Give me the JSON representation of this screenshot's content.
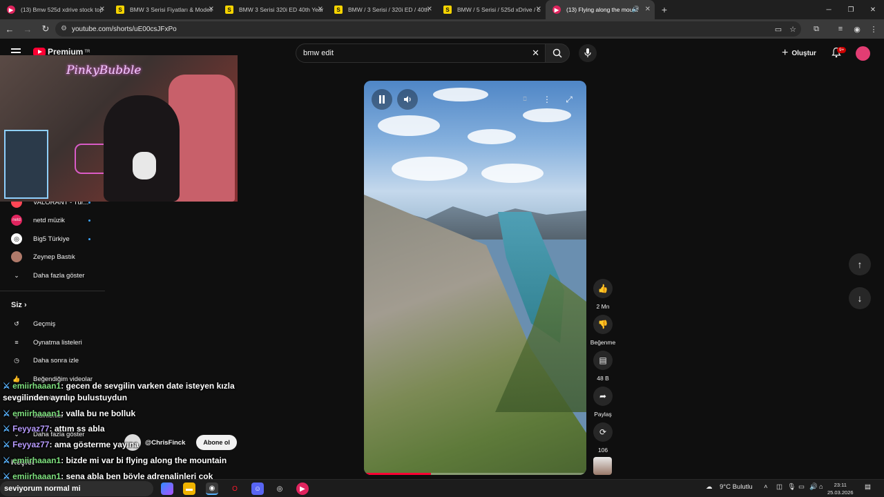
{
  "browser": {
    "tabs": [
      {
        "title": "(13) Bmw 525d xdrive stock top",
        "icon": "yt",
        "active": false
      },
      {
        "title": "BMW 3 Serisi Fiyatları & Modell",
        "icon": "s",
        "active": false
      },
      {
        "title": "BMW 3 Serisi 320i ED 40th Year",
        "icon": "s",
        "active": false
      },
      {
        "title": "BMW / 3 Serisi / 320i ED / 40th",
        "icon": "s",
        "active": false
      },
      {
        "title": "BMW / 5 Serisi / 525d xDrive / L",
        "icon": "s",
        "active": false
      },
      {
        "title": "(13) Flying along the mount",
        "icon": "yt",
        "active": true
      }
    ],
    "url": "youtube.com/shorts/uE00csJFxPo",
    "window_controls": [
      "─",
      "❐",
      "✕"
    ]
  },
  "youtube": {
    "logo_text": "Premium",
    "logo_region": "TR",
    "search_value": "bmw edit",
    "create_label": "Oluştur",
    "notification_count": "9+"
  },
  "webcam": {
    "neon_sign": "PinkyBubble"
  },
  "sidebar": {
    "subscriptions": [
      {
        "label": "VALORANT - Tür...",
        "icon_color": "#ff4655"
      },
      {
        "label": "netd müzik",
        "icon_color": "#e0245e"
      },
      {
        "label": "Big5 Türkiye",
        "icon_color": "#ffffff"
      },
      {
        "label": "Zeynep Bastık",
        "icon_color": "#b07a6a"
      }
    ],
    "show_more": "Daha fazla göster",
    "you_title": "Siz",
    "you_items": [
      {
        "label": "Geçmiş",
        "icon": "history-icon"
      },
      {
        "label": "Oynatma listeleri",
        "icon": "playlist-icon"
      },
      {
        "label": "Daha sonra izle",
        "icon": "clock-icon"
      },
      {
        "label": "Beğendiğim videolar",
        "icon": "like-icon"
      },
      {
        "label": "Videolarınız",
        "icon": "video-icon"
      },
      {
        "label": "İndirilenler",
        "icon": "download-icon"
      },
      {
        "label": "Daha fazla göster",
        "icon": "chevron-down-icon"
      }
    ],
    "explore": "Keşfet"
  },
  "chat": [
    {
      "user": "emiirhaaan1",
      "text": "gecen de sevgilin varken date isteyen kızla",
      "color": "green"
    },
    {
      "user": "",
      "text": "sevgilinden ayrılıp bulustuydun",
      "color": "green"
    },
    {
      "user": "emiirhaaan1",
      "text": "valla bu ne bolluk",
      "color": "green"
    },
    {
      "user": "Feyyaz77",
      "text": "attım ss abla",
      "color": "purple"
    },
    {
      "user": "Feyyaz77",
      "text": "ama gösterme yayına",
      "color": "purple"
    },
    {
      "user": "emiirhaaan1",
      "text": "bizde mi var bi flying along the mountain",
      "color": "green"
    },
    {
      "user": "emiirhaaan1",
      "text": "sena abla ben böyle adrenalinleri çok",
      "color": "green"
    },
    {
      "user": "",
      "text": "seviyorum normal mi",
      "color": "green"
    }
  ],
  "short": {
    "likes": "2 Mn",
    "dislike_label": "Beğenme",
    "comments": "48 B",
    "share_label": "Paylaş",
    "remix": "106",
    "progress": 0.3,
    "channel": "@ChrisFinck",
    "subscribe_label": "Abone ol"
  },
  "taskbar": {
    "weather": "9°C  Bulutlu",
    "time": "23:11",
    "date": "25.03.2026"
  }
}
